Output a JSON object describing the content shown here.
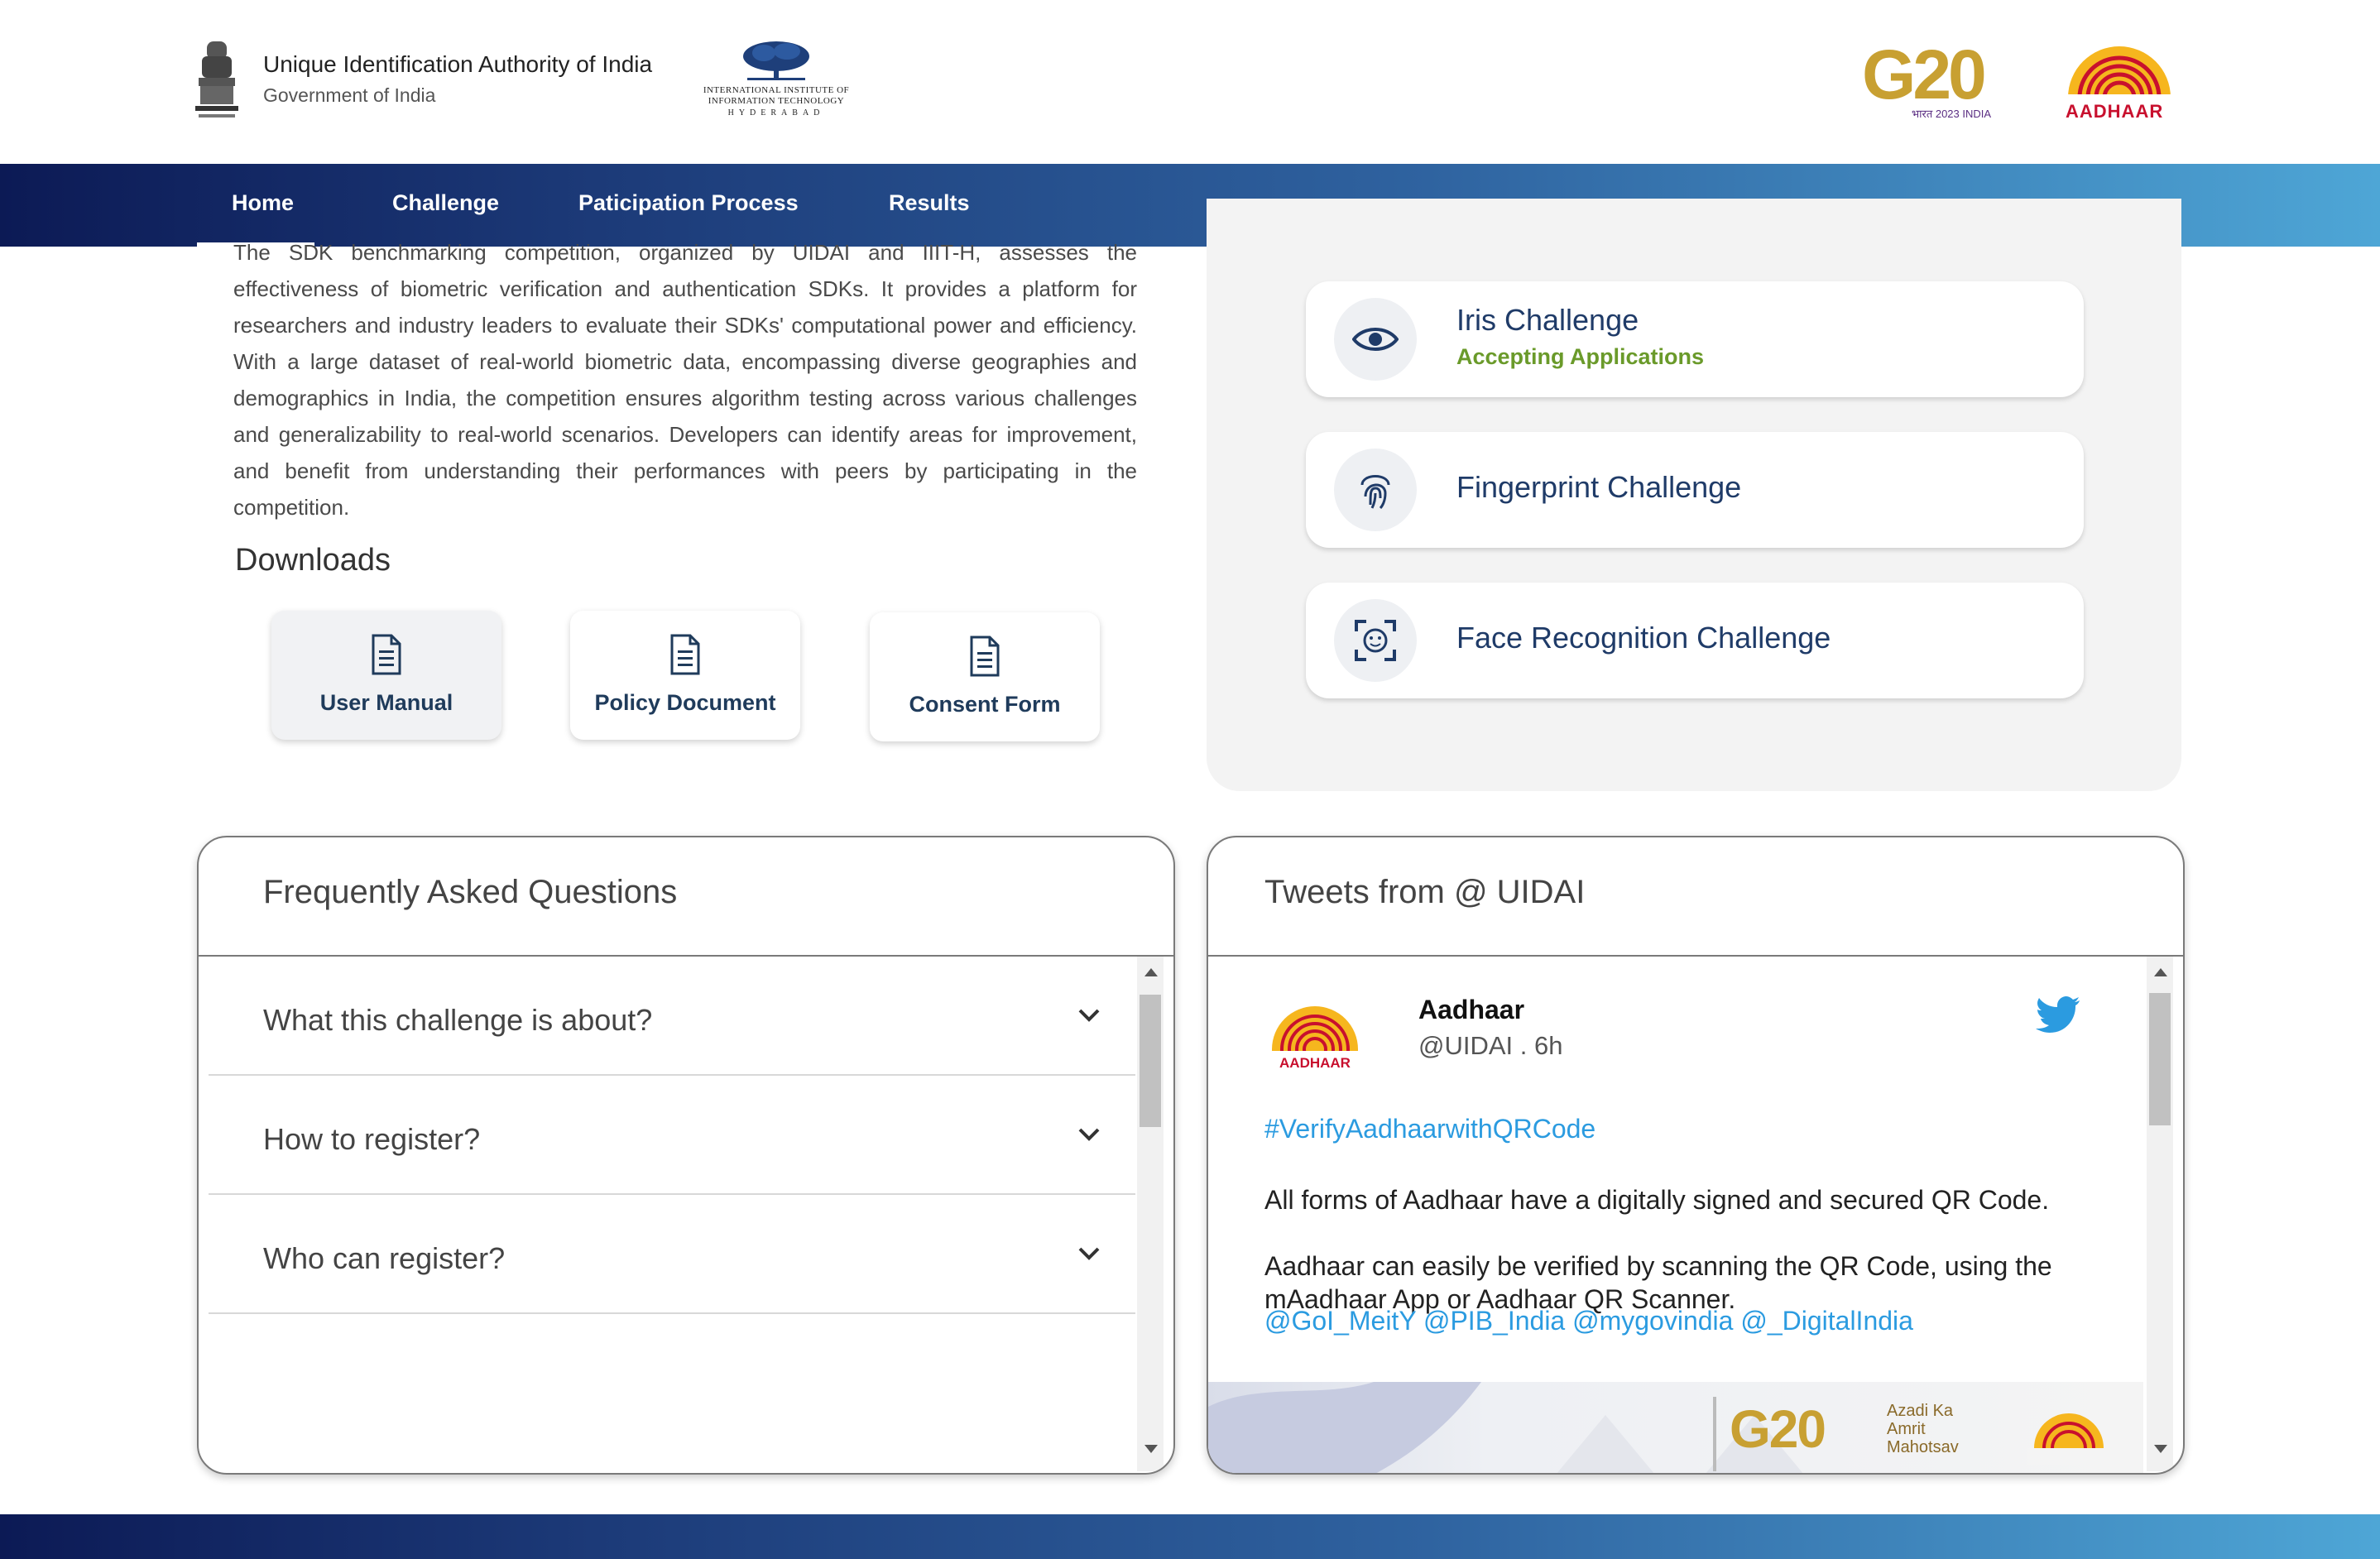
{
  "header": {
    "org_title": "Unique Identification Authority of India",
    "org_subtitle": "Government of India",
    "iiit_line1": "INTERNATIONAL INSTITUTE OF",
    "iiit_line2": "INFORMATION TECHNOLOGY",
    "iiit_city": "HYDERABAD",
    "g20_text": "G20",
    "g20_sub": "भारत 2023 INDIA",
    "aadhaar_text": "AADHAAR"
  },
  "nav": {
    "home": "Home",
    "challenge": "Challenge",
    "process": "Paticipation Process",
    "results": "Results"
  },
  "about": {
    "text": "The SDK benchmarking competition, organized by UIDAI and IIIT-H, assesses the effectiveness of biometric verification and authentication SDKs. It provides a platform for researchers and industry leaders to evaluate their SDKs' computational power and efficiency. With a large dataset of real-world biometric data, encompassing diverse geographies and demographics in India, the competition ensures algorithm testing across various challenges and generalizability to real-world scenarios. Developers can identify areas for improvement, and benefit from understanding their performances with peers by participating in the competition."
  },
  "downloads": {
    "title": "Downloads",
    "items": [
      "User Manual",
      "Policy Document",
      "Consent Form"
    ]
  },
  "challenges": [
    {
      "title": "Iris Challenge",
      "status": "Accepting Applications",
      "icon": "eye-icon"
    },
    {
      "title": "Fingerprint Challenge",
      "status": "",
      "icon": "fingerprint-icon"
    },
    {
      "title": "Face Recognition Challenge",
      "status": "",
      "icon": "face-icon"
    }
  ],
  "faq": {
    "title": "Frequently Asked Questions",
    "items": [
      "What this challenge is about?",
      "How to register?",
      "Who can register?"
    ]
  },
  "tweets": {
    "title": "Tweets from @ UIDAI",
    "name": "Aadhaar",
    "handle": "@UIDAI . 6h",
    "hashtag": "#VerifyAadhaarwithQRCode",
    "line1": "All forms of Aadhaar have a digitally signed and secured QR Code.",
    "line2": "Aadhaar can easily be verified by scanning the QR Code, using the mAadhaar App or Aadhaar QR Scanner.",
    "mentions": "@GoI_MeitY @PIB_India @mygovindia @_DigitalIndia",
    "image_g20": "G20",
    "image_azadi": "Azadi Ka Amrit Mahotsav"
  },
  "colors": {
    "nav_start": "#0c1a55",
    "nav_end": "#4ea6d6",
    "status_green": "#6a9a2a",
    "link_blue": "#2b9be0",
    "challenge_title": "#1f3b68"
  }
}
